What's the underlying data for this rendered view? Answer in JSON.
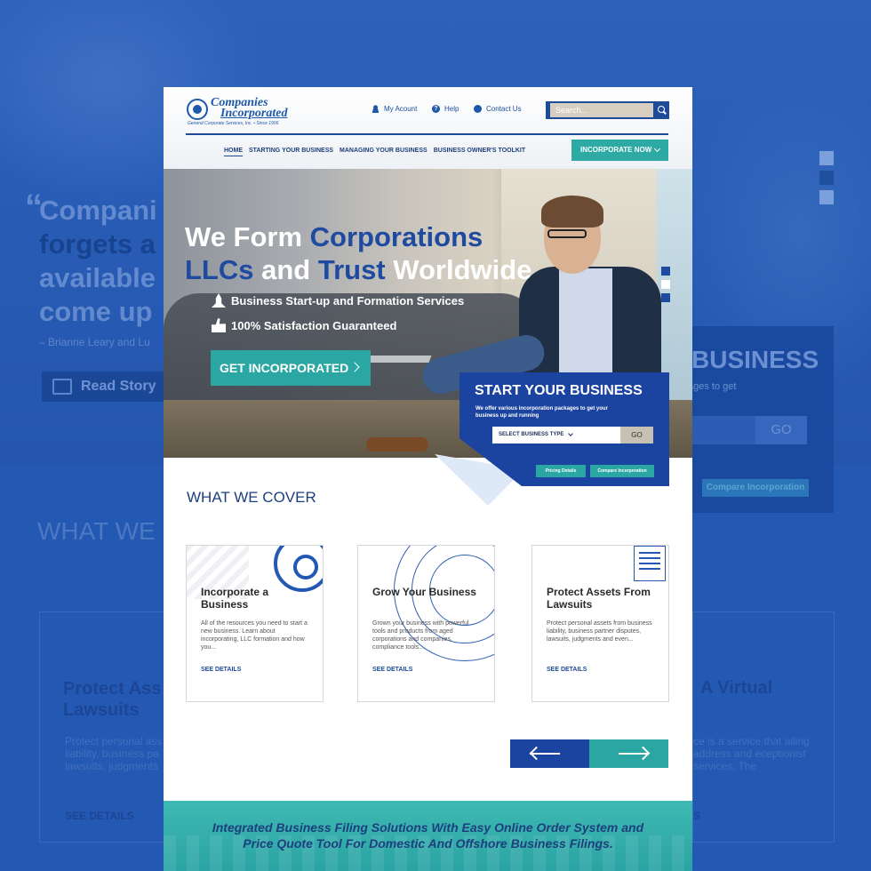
{
  "background": {
    "quote_line1": "Compani",
    "quote_line2": "forgets a",
    "quote_line3": "available",
    "quote_line4": "come up",
    "attribution": "– Brianne Leary and Lu",
    "read_story": "Read Story",
    "biz_title": "BUSINESS",
    "biz_sub": "ages to get",
    "biz_go": "GO",
    "biz_compare": "Compare Incorporation",
    "what_we": "WHAT WE C",
    "left_card_title": "Protect Ass Lawsuits",
    "left_card_desc": "Protect personal ass liability, business pa lawsuits, judgments",
    "left_card_link": "SEE DETAILS",
    "right_card_title": "A Virtual",
    "right_card_desc": "ce is a service that ailing address and eceptionist services. The",
    "right_card_link": "S"
  },
  "header": {
    "logo_line1": "Companies",
    "logo_line2": "Incorporated",
    "logo_tagline": "General Corporate Services, Inc. • Since 1906",
    "links": [
      "My Acount",
      "Help",
      "Contact Us"
    ],
    "search_placeholder": "Search...",
    "nav": [
      "HOME",
      "STARTING YOUR BUSINESS",
      "MANAGING YOUR BUSINESS",
      "BUSINESS OWNER'S TOOLKIT"
    ],
    "incorporate_now": "INCORPORATE NOW"
  },
  "hero": {
    "title_l1_a": "We Form ",
    "title_l1_b": "Corporations",
    "title_l2_a": "LLCs",
    "title_l2_b": " and ",
    "title_l2_c": "Trust",
    "title_l2_d": " Worldwide",
    "bullet1": "Business Start-up and Formation Services",
    "bullet2": "100% Satisfaction Guaranteed",
    "cta": "GET INCORPORATED"
  },
  "start_business": {
    "title": "START YOUR BUSINESS",
    "subtitle": "We offer various incorporation packages to get your business up and running",
    "select": "SELECT BUSINESS TYPE",
    "go": "GO",
    "pricing": "Pricing Details",
    "compare": "Compare Incorporation"
  },
  "what_we_cover": {
    "title": "WHAT WE COVER",
    "cards": [
      {
        "title": "Incorporate a Business",
        "desc": "All of the resources you need to start a new business. Learn about incorporating, LLC formation and how you...",
        "link": "SEE DETAILS"
      },
      {
        "title": "Grow Your Business",
        "desc": "Grown your business with powerful tools and products from aged corporations and companies, compliance tools...",
        "link": "SEE DETAILS"
      },
      {
        "title": "Protect Assets From Lawsuits",
        "desc": "Protect personal assets from business liability, business partner disputes, lawsuits, judgments and even...",
        "link": "SEE DETAILS"
      }
    ]
  },
  "footer": {
    "line1": "Integrated Business Filing Solutions With Easy Online Order System and",
    "line2": "Price Quote Tool For Domestic And Offshore Business Filings."
  },
  "colors": {
    "navy": "#1b43a0",
    "teal": "#2aa7a2",
    "backdrop": "#2358b3"
  }
}
